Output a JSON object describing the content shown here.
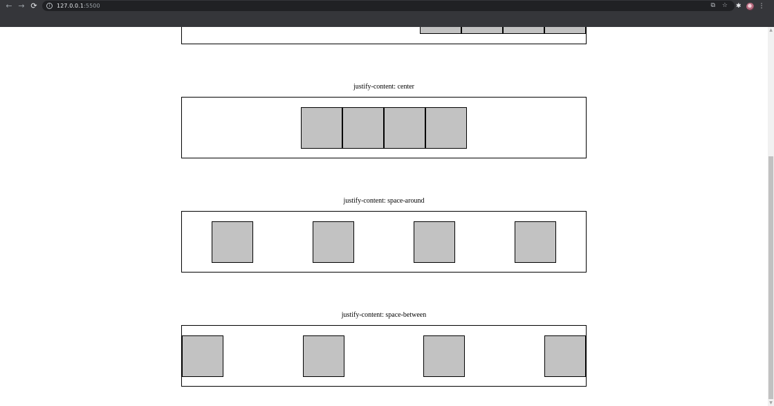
{
  "browser": {
    "url_host": "127.0.0.1",
    "url_port": ":5500",
    "nav": {
      "back_icon": "←",
      "forward_icon": "→",
      "reload_icon": "⟳"
    },
    "omnibox_icons": {
      "info_icon": "i",
      "translate_icon": "⧉",
      "bookmark_icon": "☆"
    },
    "extensions_icon": "✱",
    "menu_icon": "⋮"
  },
  "sections": [
    {
      "label": "justify-content: center",
      "mode": "center",
      "items": 4
    },
    {
      "label": "justify-content: space-around",
      "mode": "space-around",
      "items": 4
    },
    {
      "label": "justify-content: space-between",
      "mode": "space-between",
      "items": 4
    }
  ],
  "colors": {
    "item_fill": "#c2c2c2",
    "border": "#000000",
    "chrome_bg": "#35363a",
    "omnibox_bg": "#202124"
  },
  "scroll": {
    "up_arrow": "▲",
    "down_arrow": "▼"
  }
}
